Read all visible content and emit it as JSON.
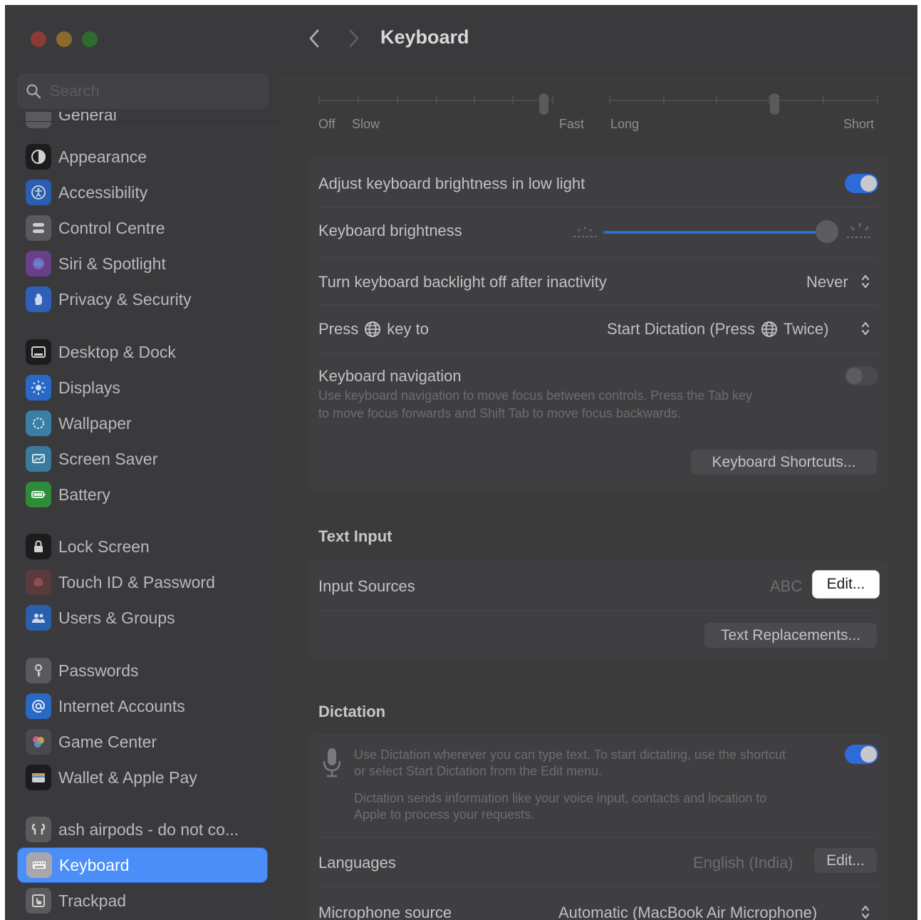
{
  "window": {
    "title": "Keyboard"
  },
  "sidebar": {
    "search_placeholder": "Search",
    "partial_item": "General",
    "items": [
      {
        "label": "Appearance",
        "icon": "appearance-icon",
        "color": "#1c1c1e"
      },
      {
        "label": "Accessibility",
        "icon": "accessibility-icon",
        "color": "#2a5fb0"
      },
      {
        "label": "Control Centre",
        "icon": "control-centre-icon",
        "color": "#5a5a5d"
      },
      {
        "label": "Siri & Spotlight",
        "icon": "siri-icon",
        "color": "#6a3f8a"
      },
      {
        "label": "Privacy & Security",
        "icon": "hand-icon",
        "color": "#2f5fb8"
      },
      {
        "label": "Desktop & Dock",
        "icon": "dock-icon",
        "color": "#1c1c1e"
      },
      {
        "label": "Displays",
        "icon": "sun-icon",
        "color": "#2a68c6"
      },
      {
        "label": "Wallpaper",
        "icon": "wallpaper-icon",
        "color": "#3b7fa6"
      },
      {
        "label": "Screen Saver",
        "icon": "screen-saver-icon",
        "color": "#3a7a9c"
      },
      {
        "label": "Battery",
        "icon": "battery-icon",
        "color": "#2f8a3a"
      },
      {
        "label": "Lock Screen",
        "icon": "lock-icon",
        "color": "#1c1c1e"
      },
      {
        "label": "Touch ID & Password",
        "icon": "fingerprint-icon",
        "color": "#5a3a3c"
      },
      {
        "label": "Users & Groups",
        "icon": "users-icon",
        "color": "#2a5fb0"
      },
      {
        "label": "Passwords",
        "icon": "key-icon",
        "color": "#5a5a5d"
      },
      {
        "label": "Internet Accounts",
        "icon": "at-icon",
        "color": "#2a68c6"
      },
      {
        "label": "Game Center",
        "icon": "game-center-icon",
        "color": "#4a4a4c"
      },
      {
        "label": "Wallet & Apple Pay",
        "icon": "wallet-icon",
        "color": "#1c1c1e"
      },
      {
        "label": "ash airpods - do not co...",
        "icon": "airpods-icon",
        "color": "#5a5a5d"
      },
      {
        "label": "Keyboard",
        "icon": "keyboard-icon",
        "color": "#a8a8ac",
        "active": true
      },
      {
        "label": "Trackpad",
        "icon": "trackpad-icon",
        "color": "#5a5a5d"
      }
    ]
  },
  "main": {
    "key_repeat_labels": {
      "off": "Off",
      "slow": "Slow",
      "fast": "Fast"
    },
    "delay_labels": {
      "long": "Long",
      "short": "Short"
    },
    "brightness": {
      "adjust_label": "Adjust keyboard brightness in low light",
      "adjust_on": true,
      "brightness_label": "Keyboard brightness",
      "brightness_level": 0.95,
      "backlight_label": "Turn keyboard backlight off after inactivity",
      "backlight_value": "Never",
      "press_key_label_a": "Press",
      "press_key_label_b": "key to",
      "press_key_value_a": "Start Dictation (Press",
      "press_key_value_b": "Twice)",
      "nav_label": "Keyboard navigation",
      "nav_desc_1": "Use keyboard navigation to move focus between controls. Press the Tab key",
      "nav_desc_2": "to move focus forwards and Shift Tab to move focus backwards.",
      "nav_on": false,
      "shortcuts_button": "Keyboard Shortcuts..."
    },
    "text_input": {
      "title": "Text Input",
      "input_sources_label": "Input Sources",
      "input_sources_value": "ABC",
      "edit_button": "Edit...",
      "replacements_button": "Text Replacements..."
    },
    "dictation": {
      "title": "Dictation",
      "desc_1": "Use Dictation wherever you can type text. To start dictating, use the shortcut",
      "desc_2": "or select Start Dictation from the Edit menu.",
      "desc_3": "Dictation sends information like your voice input, contacts and location to",
      "desc_4": "Apple to process your requests.",
      "dictation_on": true,
      "languages_label": "Languages",
      "languages_value": "English (India)",
      "languages_edit": "Edit...",
      "mic_label": "Microphone source",
      "mic_value": "Automatic (MacBook Air Microphone)"
    }
  },
  "colors": {
    "accent": "#4c8ef8",
    "toggle_on": "#2d6bd8"
  }
}
